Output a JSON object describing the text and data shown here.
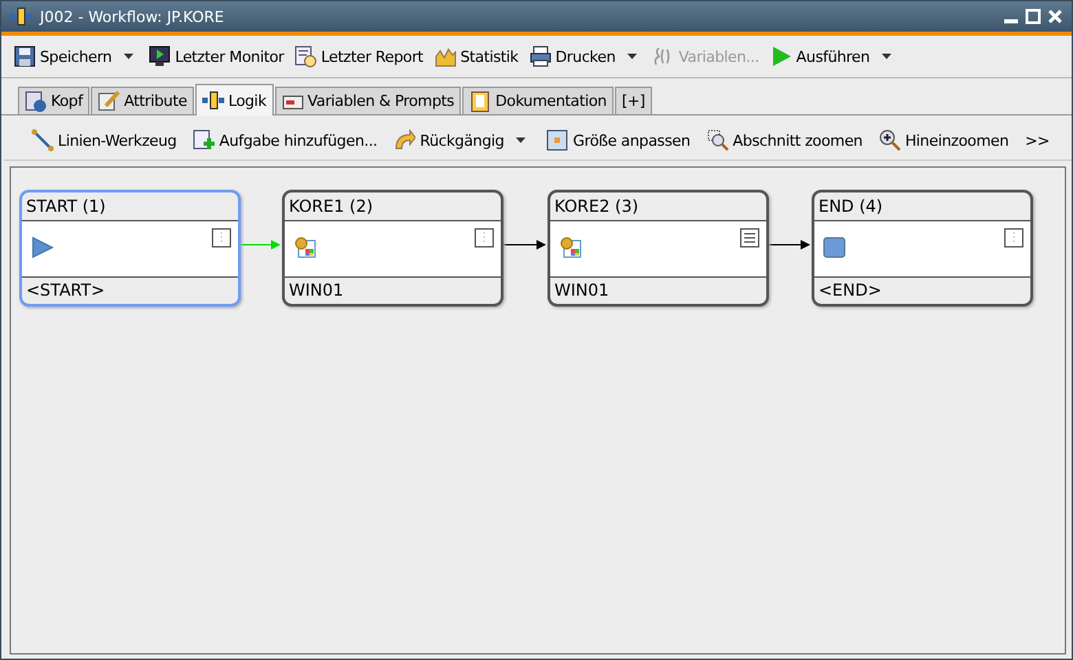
{
  "window": {
    "title": "J002 - Workflow: JP.KORE"
  },
  "toolbar": [
    {
      "label": "Speichern",
      "dropdown": true,
      "disabled": false
    },
    {
      "label": "Letzter Monitor",
      "dropdown": false,
      "disabled": false
    },
    {
      "label": "Letzter Report",
      "dropdown": false,
      "disabled": false
    },
    {
      "label": "Statistik",
      "dropdown": false,
      "disabled": false
    },
    {
      "label": "Drucken",
      "dropdown": true,
      "disabled": false
    },
    {
      "label": "Variablen...",
      "dropdown": false,
      "disabled": true
    },
    {
      "label": "Ausführen",
      "dropdown": true,
      "disabled": false
    }
  ],
  "tabs": [
    {
      "label": "Kopf",
      "selected": false
    },
    {
      "label": "Attribute",
      "selected": false
    },
    {
      "label": "Logik",
      "selected": true
    },
    {
      "label": "Variablen & Prompts",
      "selected": false
    },
    {
      "label": "Dokumentation",
      "selected": false
    },
    {
      "label": "[+]",
      "selected": false
    }
  ],
  "logic_toolbar": [
    {
      "label": "Linien-Werkzeug",
      "dropdown": false
    },
    {
      "label": "Aufgabe hinzufügen...",
      "dropdown": false
    },
    {
      "label": "Rückgängig",
      "dropdown": true
    },
    {
      "label": "Größe anpassen",
      "dropdown": false
    },
    {
      "label": "Abschnitt zoomen",
      "dropdown": false
    },
    {
      "label": "Hineinzoomen",
      "dropdown": false
    },
    {
      "label": ">>",
      "dropdown": false
    }
  ],
  "nodes": [
    {
      "title": "START (1)",
      "kind": "start",
      "footer": "<START>",
      "selected": true,
      "documented": false
    },
    {
      "title": "KORE1 (2)",
      "kind": "task",
      "footer": "WIN01",
      "selected": false,
      "documented": false
    },
    {
      "title": "KORE2 (3)",
      "kind": "task",
      "footer": "WIN01",
      "selected": false,
      "documented": true
    },
    {
      "title": "END (4)",
      "kind": "end",
      "footer": "<END>",
      "selected": false,
      "documented": false
    }
  ],
  "connections": [
    {
      "color": "#00e000"
    },
    {
      "color": "#000000"
    },
    {
      "color": "#000000"
    }
  ]
}
